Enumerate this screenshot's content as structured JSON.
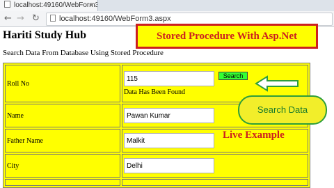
{
  "browser": {
    "tab_title": "localhost:49160/WebForm3",
    "tab_close": "×",
    "address": "localhost:49160/WebForm3.aspx",
    "nav": {
      "back": "←",
      "forward": "→",
      "reload": "↻"
    }
  },
  "page": {
    "title": "Hariti Study Hub",
    "subtitle": "Search Data From Database Using Stored Procedure"
  },
  "overlay": {
    "banner": "Stored Procedure With Asp.Net",
    "callout": "Search Data",
    "live_label": "Live Example",
    "colors": {
      "banner_border": "#cc1f1f",
      "highlight": "#ffff00",
      "callout_text": "#1a7b2b"
    }
  },
  "form": {
    "roll_no": {
      "label": "Roll No",
      "value": "115"
    },
    "search_button": "Search",
    "status": "Data Has Been Found",
    "name": {
      "label": "Name",
      "value": "Pawan Kumar"
    },
    "father_name": {
      "label": "Father Name",
      "value": "Malkit"
    },
    "city": {
      "label": "City",
      "value": "Delhi"
    }
  },
  "icons": [
    "page-icon",
    "back-arrow-icon",
    "forward-arrow-icon",
    "reload-icon",
    "arrow-left-icon"
  ]
}
